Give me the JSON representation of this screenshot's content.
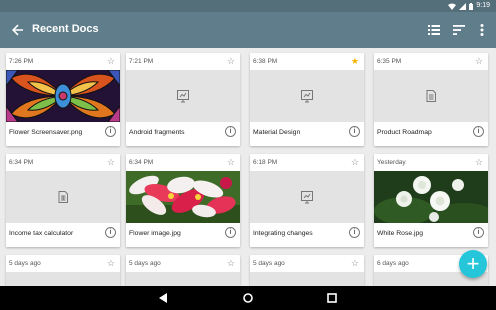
{
  "status_bar": {
    "time": "9:19",
    "icons": [
      "wifi-icon",
      "signal-icon",
      "battery-icon"
    ]
  },
  "app_bar": {
    "title": "Recent Docs",
    "actions": [
      "list-view-icon",
      "sort-icon"
    ],
    "nav_icon": "back-arrow-icon"
  },
  "docs": [
    {
      "time": "7:26 PM",
      "name": "Flower Screensaver.png",
      "starred": false,
      "thumb": "stained-glass-image"
    },
    {
      "time": "7:21 PM",
      "name": "Android fragments",
      "starred": false,
      "thumb": "presentation-icon"
    },
    {
      "time": "6:38 PM",
      "name": "Material Design",
      "starred": true,
      "thumb": "presentation-icon"
    },
    {
      "time": "6:35 PM",
      "name": "Product Roadmap",
      "starred": false,
      "thumb": "document-icon"
    },
    {
      "time": "6:34 PM",
      "name": "Income tax calculator",
      "starred": false,
      "thumb": "spreadsheet-icon"
    },
    {
      "time": "6:34 PM",
      "name": "Flower image.jpg",
      "starred": false,
      "thumb": "lily-flower-image"
    },
    {
      "time": "6:18 PM",
      "name": "Integrating changes",
      "starred": false,
      "thumb": "presentation-icon"
    },
    {
      "time": "Yesterday",
      "name": "White Rose.jpg",
      "starred": false,
      "thumb": "white-rose-image"
    },
    {
      "time": "5 days ago",
      "starred": false
    },
    {
      "time": "5 days ago",
      "starred": false
    },
    {
      "time": "5 days ago",
      "starred": false
    },
    {
      "time": "6 days ago",
      "starred": false
    }
  ],
  "fab": {
    "label": "+",
    "icon": "add-icon"
  },
  "nav_bar": {
    "buttons": [
      "back-icon",
      "home-icon",
      "recents-icon"
    ]
  },
  "colors": {
    "status_bar": "#546e7a",
    "app_bar": "#607d8b",
    "star_on": "#f5b400",
    "fab": "#26c6da"
  }
}
